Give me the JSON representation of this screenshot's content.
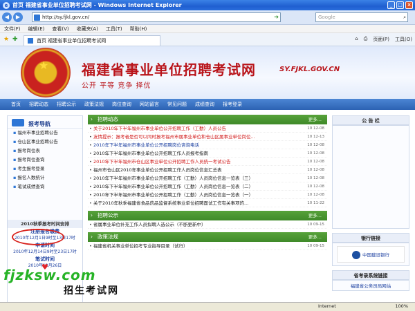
{
  "window": {
    "title": "首页 福建省事业单位招聘考试网 - Windows Internet Explorer",
    "controls": [
      "_",
      "□",
      "×"
    ]
  },
  "address": {
    "url": "http://sy.fjkl.gov.cn/",
    "search_placeholder": "Google"
  },
  "menu": [
    "文件(F)",
    "编辑(E)",
    "查看(V)",
    "收藏夹(A)",
    "工具(T)",
    "帮助(H)"
  ],
  "tab": {
    "label": "首页 福建省事业单位招聘考试网"
  },
  "tools": [
    "页面(P)",
    "工具(O)"
  ],
  "banner": {
    "site_name": "福建省事业单位招聘考试网",
    "slogan": "公开 平等 竞争 择优",
    "site_url": "SY.FJKL.GOV.CN"
  },
  "nav": [
    "首页",
    "招聘动态",
    "招聘公示",
    "政策法规",
    "岗位查询",
    "网站留言",
    "常见问题",
    "成绩查询",
    "报考登录"
  ],
  "left": {
    "title": "报考导航",
    "items": [
      "福州市事业招聘公告",
      "仓山区事业招聘公告",
      "报考岗位表",
      "报考岗位查询",
      "考生报考登录",
      "报名人数统计",
      "笔试成绩查询"
    ],
    "exam_title": "2010秋季报考时间安排",
    "lines": [
      {
        "text": "注册报名缴费",
        "bold": true
      },
      {
        "text": "2010年12月1日9时至13日17时",
        "bold": false
      },
      {
        "text": "申请时间",
        "bold": true
      },
      {
        "text": "2010年12月14日9时至23日17时",
        "bold": false
      },
      {
        "text": "笔试时间",
        "bold": true
      },
      {
        "text": "2010年12月26日",
        "bold": false
      }
    ]
  },
  "center": {
    "sections": [
      {
        "title": "招聘动态",
        "more": "更多...",
        "items": [
          {
            "text": "关于2010年下半年福州市事业单位公开招聘工作（工勤）人员公告",
            "date": "10 12-08",
            "color": "red"
          },
          {
            "text": "友情提示：报考者是否可以同时报考福州市属事业单位和仓山区属事业单位岗位...",
            "date": "10 12-13",
            "color": "red"
          },
          {
            "text": "2010年下半年福州市事业单位公开招聘岗位咨询电话",
            "date": "10 12-08",
            "color": "blue"
          },
          {
            "text": "2010年下半年福州市事业单位公开招聘工作人员报考指南",
            "date": "10 12-08",
            "color": "dark"
          },
          {
            "text": "2010年下半年福州市仓山区事业单位公开招聘工作人员统一考试公告",
            "date": "10 12-08",
            "color": "red"
          },
          {
            "text": "福州市仓山区2010年事业单位公开招聘工作人员岗位信息汇总表",
            "date": "10 12-08",
            "color": "dark"
          },
          {
            "text": "2010年下半年福州市事业单位公开招聘工作（工勤）人员岗位信息一览表（三）",
            "date": "10 12-08",
            "color": "dark"
          },
          {
            "text": "2010年下半年福州市事业单位公开招聘工作（工勤）人员岗位信息一览表（二）",
            "date": "10 12-08",
            "color": "dark"
          },
          {
            "text": "2010年下半年福州市事业单位公开招聘工作（工勤）人员岗位信息一览表（一）",
            "date": "10 12-08",
            "color": "dark"
          },
          {
            "text": "关于2010年秋季福建省食品药品监督系统事业单位招聘面试工作有关事项的...",
            "date": "10 11-22",
            "color": "dark"
          }
        ]
      },
      {
        "title": "招聘公示",
        "more": "更多...",
        "items": [
          {
            "text": "省属事业单位补充工作人员拟聘人选公示（不断更新中）",
            "date": "10 09-15",
            "color": "dark"
          }
        ]
      },
      {
        "title": "政策法规",
        "more": "更多...",
        "items": [
          {
            "text": "福建省机关事业单位招考专业指导目录（试行）",
            "date": "10 09-15",
            "color": "dark"
          }
        ]
      }
    ]
  },
  "right": {
    "notice_title": "公 告 栏",
    "bank_title": "银行链接",
    "bank_name": "中国建设银行",
    "links_title": "省考录系统链接",
    "links_item": "福建省公务员局网站"
  },
  "watermark": {
    "url": "fjzksw.com",
    "text": "招生考试网"
  },
  "status": {
    "zone": "Internet",
    "zoom": "100%"
  }
}
